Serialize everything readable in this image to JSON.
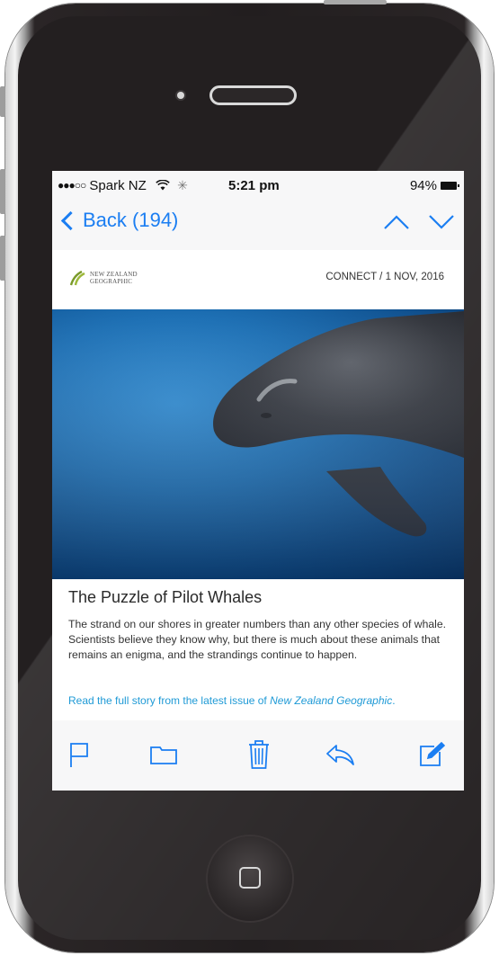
{
  "status_bar": {
    "signal": "●●●○○",
    "carrier": "Spark NZ",
    "time": "5:21 pm",
    "battery": "94%"
  },
  "nav": {
    "back_label": "Back (194)"
  },
  "email": {
    "brand": {
      "line1": "NEW ZEALAND",
      "line2": "GEOGRAPHIC"
    },
    "dateline": "CONNECT / 1 NOV, 2016",
    "title": "The Puzzle of Pilot Whales",
    "body": "The strand on our shores in greater numbers than any other species of whale. Scientists believe they know why, but there is much about these animals that remains an enigma, and the strandings continue to happen.",
    "link_prefix": "Read the full story from the latest issue of ",
    "link_italic": "New Zealand Geographic",
    "link_suffix": "."
  },
  "toolbar": {
    "icons": [
      "flag-icon",
      "folder-icon",
      "trash-icon",
      "reply-icon",
      "compose-icon"
    ]
  },
  "colors": {
    "accent": "#1b7ef2",
    "link": "#1f9ad6",
    "phone_body": "#231f20"
  }
}
